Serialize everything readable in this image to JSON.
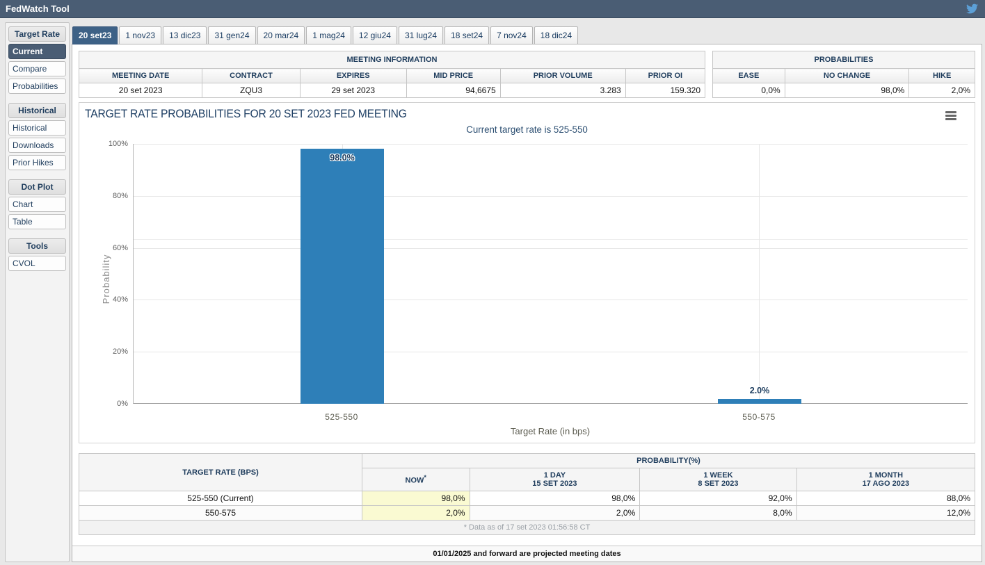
{
  "titlebar": {
    "title": "FedWatch Tool",
    "twitter_icon": "twitter-bird",
    "bg_color": "#4a5d74"
  },
  "tabs": {
    "items": [
      {
        "label": "20 set23",
        "active": true
      },
      {
        "label": "1 nov23",
        "active": false
      },
      {
        "label": "13 dic23",
        "active": false
      },
      {
        "label": "31 gen24",
        "active": false
      },
      {
        "label": "20 mar24",
        "active": false
      },
      {
        "label": "1 mag24",
        "active": false
      },
      {
        "label": "12 giu24",
        "active": false
      },
      {
        "label": "31 lug24",
        "active": false
      },
      {
        "label": "18 set24",
        "active": false
      },
      {
        "label": "7 nov24",
        "active": false
      },
      {
        "label": "18 dic24",
        "active": false
      }
    ],
    "active_color": "#3d6186"
  },
  "sidebar": {
    "groups": [
      {
        "header": "Target Rate",
        "items": [
          {
            "label": "Current",
            "active": true
          },
          {
            "label": "Compare",
            "active": false
          },
          {
            "label": "Probabilities",
            "active": false
          }
        ]
      },
      {
        "header": "Historical",
        "items": [
          {
            "label": "Historical",
            "active": false
          },
          {
            "label": "Downloads",
            "active": false
          },
          {
            "label": "Prior Hikes",
            "active": false
          }
        ]
      },
      {
        "header": "Dot Plot",
        "items": [
          {
            "label": "Chart",
            "active": false
          },
          {
            "label": "Table",
            "active": false
          }
        ]
      },
      {
        "header": "Tools",
        "items": [
          {
            "label": "CVOL",
            "active": false
          }
        ]
      }
    ]
  },
  "meeting_info": {
    "title": "MEETING INFORMATION",
    "columns": [
      "MEETING DATE",
      "CONTRACT",
      "EXPIRES",
      "MID PRICE",
      "PRIOR VOLUME",
      "PRIOR OI"
    ],
    "values": [
      "20 set 2023",
      "ZQU3",
      "29 set 2023",
      "94,6675",
      "3.283",
      "159.320"
    ]
  },
  "probabilities_summary": {
    "title": "PROBABILITIES",
    "columns": [
      "EASE",
      "NO CHANGE",
      "HIKE"
    ],
    "values": [
      "0,0%",
      "98,0%",
      "2,0%"
    ]
  },
  "chart_data": {
    "type": "bar",
    "title": "TARGET RATE PROBABILITIES FOR 20 SET 2023 FED MEETING",
    "subtitle": "Current target rate is 525-550",
    "categories": [
      "525-550",
      "550-575"
    ],
    "values": [
      98.0,
      2.0
    ],
    "data_labels": [
      "98.0%",
      "2.0%"
    ],
    "xlabel": "Target Rate (in bps)",
    "ylabel": "Probability",
    "ylim": [
      0,
      100
    ],
    "y_ticks": [
      "100%",
      "80%",
      "60%",
      "40%",
      "20%",
      "0%"
    ],
    "grid": true,
    "legend": "none",
    "bar_color": "#2e7fb8",
    "menu_icon": "hamburger-menu"
  },
  "bottom_table": {
    "row_header": "TARGET RATE (BPS)",
    "group_header": "PROBABILITY(%)",
    "now_label": "NOW",
    "now_sup": "*",
    "period_columns": [
      {
        "label": "1 DAY",
        "date": "15 SET 2023"
      },
      {
        "label": "1 WEEK",
        "date": "8 SET 2023"
      },
      {
        "label": "1 MONTH",
        "date": "17 AGO 2023"
      }
    ],
    "rows": [
      {
        "target": "525-550 (Current)",
        "now": "98,0%",
        "day": "98,0%",
        "week": "92,0%",
        "month": "88,0%"
      },
      {
        "target": "550-575",
        "now": "2,0%",
        "day": "2,0%",
        "week": "8,0%",
        "month": "12,0%"
      }
    ],
    "footnote": "* Data as of 17 set 2023 01:56:58 CT",
    "now_highlight_color": "#fafad2"
  },
  "projected_note": "01/01/2025 and forward are projected meeting dates"
}
